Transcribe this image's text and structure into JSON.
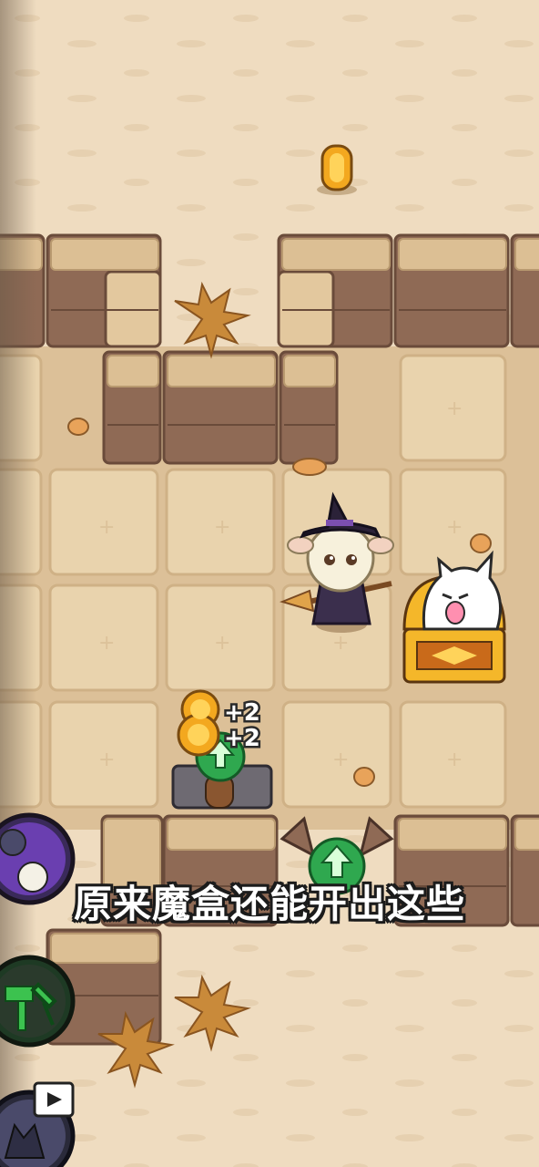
{
  "subtitle": "原来魔盒还能开出这些",
  "reward_popups": [
    "+2",
    "+2"
  ],
  "icons": {
    "coin": "gold-coin-icon",
    "chest": "treasure-chest-icon",
    "upgrade": "green-up-arrow-icon",
    "left_buttons": [
      "wolf-sheep-portrait-icon",
      "hammer-build-icon",
      "wolf-video-ad-icon"
    ]
  },
  "colors": {
    "sand": "#efdcc0",
    "floor_tile": "#e7cfa8",
    "wall_top": "#dcbf94",
    "wall_brick": "#8f6a55",
    "upgrade_green": "#2fa84f",
    "chest_gold": "#f4b72a"
  }
}
